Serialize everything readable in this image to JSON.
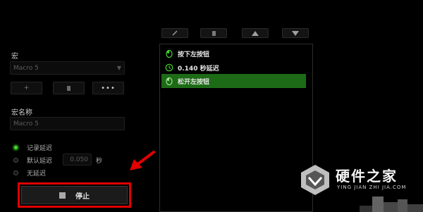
{
  "macro_panel": {
    "label": "宏",
    "select_value": "Macro 5",
    "buttons": {
      "add": "+",
      "more": "•••"
    },
    "name_label": "宏名称",
    "name_value": "Macro 5"
  },
  "delay_options": {
    "record": "记录延迟",
    "default": "默认延迟",
    "default_value": "0.050",
    "unit": "秒",
    "none": "无延迟"
  },
  "stop_button": {
    "label": "停止"
  },
  "event_list": [
    {
      "text": "按下左按钮",
      "icon": "mouse-left-icon",
      "highlight": false
    },
    {
      "text": "0.140 秒延迟",
      "icon": "clock-icon",
      "highlight": false
    },
    {
      "text": "松开左按钮",
      "icon": "mouse-left-icon",
      "highlight": true
    }
  ],
  "toolbar": {
    "icons": [
      "pencil-icon",
      "trash-icon",
      "arrow-up-icon",
      "arrow-down-icon"
    ]
  },
  "watermark": {
    "title": "硬件之家",
    "subtitle": "YING JIAN ZHI JIA.COM"
  },
  "colors": {
    "accent_green": "#44d62c",
    "highlight_row": "#1d6b16",
    "annotation_red": "#e00000"
  }
}
